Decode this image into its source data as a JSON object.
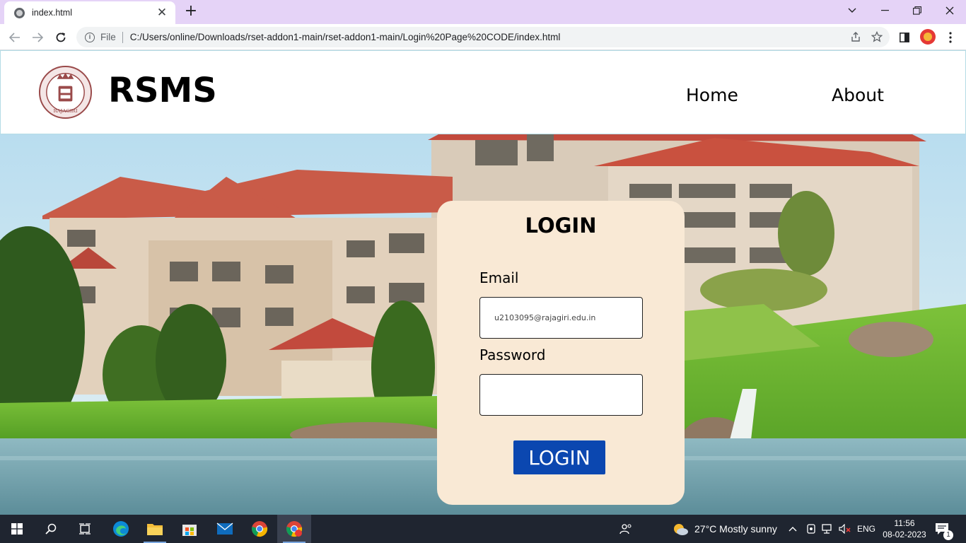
{
  "browser": {
    "tab_title": "index.html",
    "url_scheme": "File",
    "url": "C:/Users/online/Downloads/rset-addon1-main/rset-addon1-main/Login%20Page%20CODE/index.html"
  },
  "site": {
    "brand": "RSMS",
    "logo_icon": "rajagiri-seal-icon",
    "nav": [
      {
        "label": "Home"
      },
      {
        "label": "About"
      }
    ]
  },
  "login": {
    "title": "LOGIN",
    "email_label": "Email",
    "email_value": "u2103095@rajagiri.edu.in",
    "password_label": "Password",
    "password_value": "",
    "submit_label": "LOGIN",
    "card_color": "#f9e9d5",
    "button_color": "#0b47b0"
  },
  "taskbar": {
    "weather": "27°C  Mostly sunny",
    "language": "ENG",
    "time": "11:56",
    "date": "08-02-2023",
    "notification_count": "1"
  }
}
